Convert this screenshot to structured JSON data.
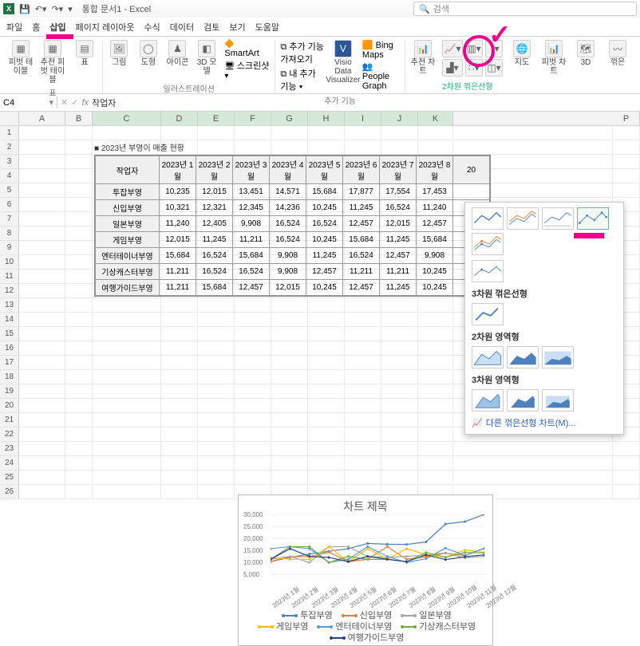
{
  "titlebar": {
    "title": "통합 문서1 - Excel",
    "search_placeholder": "검색"
  },
  "tabs": [
    "파일",
    "홈",
    "삽입",
    "페이지 레이아웃",
    "수식",
    "데이터",
    "검토",
    "보기",
    "도움말"
  ],
  "active_tab": "삽입",
  "ribbon": {
    "groups": {
      "table": {
        "items": [
          "피벗\n테이블",
          "추천\n피벗 테이블",
          "표"
        ],
        "label": "표"
      },
      "illust": {
        "items": [
          "그림",
          "도형",
          "아이콘",
          "3D\n모델",
          "SmartArt",
          "스크린샷"
        ],
        "label": "일러스트레이션"
      },
      "addins": {
        "items": [
          "추가 기능 가져오기",
          "내 추가 기능",
          "Visio Data\nVisualizer",
          "Bing Maps",
          "People Graph"
        ],
        "label": "추가 기능"
      },
      "charts": {
        "items": [
          "추천\n차트"
        ],
        "label_sel": "2차원 꺾은선형",
        "others": [
          "지도",
          "피벗 차트",
          "3D"
        ],
        "label": ""
      }
    }
  },
  "namebox": "C4",
  "formula": "작업자",
  "columns": [
    "A",
    "B",
    "C",
    "D",
    "E",
    "F",
    "G",
    "H",
    "I",
    "J",
    "K",
    "P"
  ],
  "table_title": "■ 2023년 부영이 매출 현황",
  "headers": [
    "작업자",
    "2023년 1월",
    "2023년 2월",
    "2023년 3월",
    "2023년 4월",
    "2023년 5월",
    "2023년 6월",
    "2023년 7월",
    "2023년 8월",
    "20"
  ],
  "rows": [
    {
      "label": "투잡부영",
      "v": [
        "10,235",
        "12,015",
        "13,451",
        "14,571",
        "15,684",
        "17,877",
        "17,554",
        "17,453"
      ]
    },
    {
      "label": "신입부영",
      "v": [
        "10,321",
        "12,321",
        "12,345",
        "14,236",
        "10,245",
        "11,245",
        "16,524",
        "11,240"
      ]
    },
    {
      "label": "일본부영",
      "v": [
        "11,240",
        "12,405",
        "9,908",
        "16,524",
        "16,524",
        "12,457",
        "12,015",
        "12,457"
      ]
    },
    {
      "label": "게임부영",
      "v": [
        "12,015",
        "11,245",
        "11,211",
        "16,524",
        "10,245",
        "15,684",
        "11,245",
        "15,684"
      ]
    },
    {
      "label": "엔터테이너부영",
      "v": [
        "15,684",
        "16,524",
        "15,684",
        "9,908",
        "11,245",
        "16,524",
        "12,457",
        "9,908"
      ]
    },
    {
      "label": "기상캐스터부영",
      "v": [
        "11,211",
        "16,524",
        "16,524",
        "9,908",
        "12,457",
        "11,211",
        "11,211",
        "10,245"
      ]
    },
    {
      "label": "여행가이드부영",
      "v": [
        "11,211",
        "15,684",
        "12,457",
        "12,015",
        "10,245",
        "12,457",
        "11,245",
        "10,245"
      ]
    }
  ],
  "chart_panel": {
    "section1": "2차원 꺾은선형",
    "section2": "3차원 꺾은선형",
    "section3": "2차원 영역형",
    "section4": "3차원 영역형",
    "more": "다른 꺾은선형 차트(M)..."
  },
  "chart_data": {
    "type": "line",
    "title": "차트 제목",
    "categories": [
      "2023년 1월",
      "2023년 2월",
      "2023년 3월",
      "2023년 4월",
      "2023년 5월",
      "2023년 6월",
      "2023년 7월",
      "2023년 8월",
      "2023년 9월",
      "2023년 10월",
      "2023년 11월",
      "2023년 12월"
    ],
    "series": [
      {
        "name": "투잡부영",
        "color": "#4f81bd",
        "values": [
          10235,
          12015,
          13451,
          14571,
          15684,
          17877,
          17554,
          17453,
          18500,
          26000,
          27000,
          30000
        ]
      },
      {
        "name": "신입부영",
        "color": "#ed7d31",
        "values": [
          10321,
          12321,
          12345,
          14236,
          10245,
          11245,
          16524,
          11240,
          12300,
          13800,
          12800,
          15800
        ]
      },
      {
        "name": "일본부영",
        "color": "#a5a5a5",
        "values": [
          11240,
          12405,
          9908,
          16524,
          16524,
          12457,
          12015,
          12457,
          13100,
          13900,
          11800,
          12500
        ]
      },
      {
        "name": "게임부영",
        "color": "#ffc000",
        "values": [
          12015,
          11245,
          11211,
          16524,
          10245,
          15684,
          11245,
          15684,
          13200,
          12100,
          15100,
          14100
        ]
      },
      {
        "name": "엔터테이너부영",
        "color": "#5b9bd5",
        "values": [
          15684,
          16524,
          15684,
          9908,
          11245,
          16524,
          12457,
          9908,
          11500,
          15900,
          12900,
          15900
        ]
      },
      {
        "name": "기상캐스터부영",
        "color": "#70ad47",
        "values": [
          11211,
          16524,
          16524,
          9908,
          12457,
          11211,
          11211,
          10245,
          14100,
          12100,
          14100,
          13900
        ]
      },
      {
        "name": "여행가이드부영",
        "color": "#264478",
        "values": [
          11211,
          15684,
          12457,
          12015,
          10245,
          12457,
          11245,
          10245,
          13100,
          11100,
          12300,
          13100
        ]
      }
    ],
    "y_ticks": [
      5000,
      10000,
      15000,
      20000,
      25000,
      30000
    ],
    "ylim": [
      0,
      30000
    ]
  }
}
